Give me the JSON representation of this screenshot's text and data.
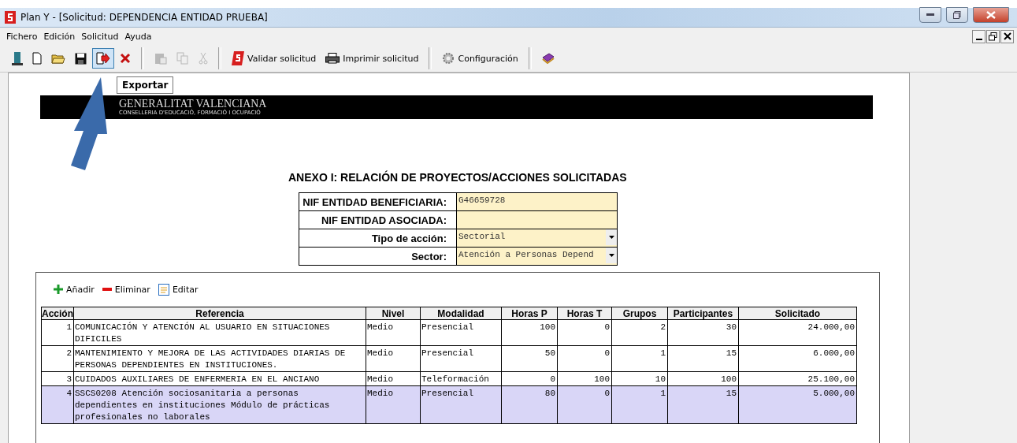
{
  "window": {
    "title": "Plan Y - [Solicitud: DEPENDENCIA ENTIDAD PRUEBA]"
  },
  "menu": [
    "Fichero",
    "Edición",
    "Solicitud",
    "Ayuda"
  ],
  "toolbar": [
    {
      "kind": "icon",
      "pressed": false,
      "disabled": false
    },
    {
      "kind": "icon",
      "pressed": false,
      "disabled": false
    },
    {
      "kind": "icon",
      "pressed": false,
      "disabled": false
    },
    {
      "kind": "icon",
      "pressed": false,
      "disabled": false
    },
    {
      "kind": "icon",
      "pressed": true,
      "disabled": false
    },
    {
      "kind": "icon",
      "pressed": false,
      "disabled": false
    },
    {
      "kind": "separator"
    },
    {
      "kind": "icon",
      "pressed": false,
      "disabled": true
    },
    {
      "kind": "icon",
      "pressed": false,
      "disabled": true
    },
    {
      "kind": "icon",
      "pressed": false,
      "disabled": true
    },
    {
      "kind": "separator"
    },
    {
      "kind": "labeled",
      "label": "Validar solicitud",
      "pressed": false,
      "disabled": false
    },
    {
      "kind": "labeled",
      "label": "Imprimir solicitud",
      "pressed": false,
      "disabled": false
    },
    {
      "kind": "separator"
    },
    {
      "kind": "labeled",
      "label": "Configuración",
      "pressed": false,
      "disabled": false
    },
    {
      "kind": "separator"
    },
    {
      "kind": "icon",
      "pressed": false,
      "disabled": false
    }
  ],
  "tooltip": "Exportar",
  "banner": {
    "title": "GENERALITAT VALENCIANA",
    "subtitle": "CONSELLERIA D'EDUCACIÓ, FORMACIÓ I OCUPACIÓ"
  },
  "heading": "ANEXO I: RELACIÓN DE PROYECTOS/ACCIONES SOLICITADAS",
  "form": [
    {
      "kind": "text",
      "label": "NIF ENTIDAD BENEFICIARIA:",
      "value": "G46659728"
    },
    {
      "kind": "text",
      "label": "NIF ENTIDAD ASOCIADA:"
    },
    {
      "kind": "select",
      "label": "Tipo de acción:",
      "value": "Sectorial"
    },
    {
      "kind": "select",
      "label": "Sector:",
      "value": "Atención a Personas Depend"
    }
  ],
  "grid_toolbar": [
    "Añadir",
    "Eliminar",
    "Editar"
  ],
  "table": {
    "columns": [
      "Acción",
      "Referencia",
      "Nivel",
      "Modalidad",
      "Horas P",
      "Horas T",
      "Grupos",
      "Participantes",
      "Solicitado"
    ],
    "rows": [
      {
        "selected": false,
        "cells": [
          "1",
          "COMUNICACIÓN Y ATENCIÓN AL USUARIO EN SITUACIONES DIFICILES",
          "Medio",
          "Presencial",
          "100",
          "0",
          "2",
          "30",
          "24.000,00"
        ]
      },
      {
        "selected": false,
        "cells": [
          "2",
          "MANTENIMIENTO Y MEJORA DE LAS ACTIVIDADES DIARIAS DE PERSONAS DEPENDIENTES EN INSTITUCIONES.",
          "Medio",
          "Presencial",
          "50",
          "0",
          "1",
          "15",
          "6.000,00"
        ]
      },
      {
        "selected": false,
        "cells": [
          "3",
          "CUIDADOS AUXILIARES DE ENFERMERIA EN EL ANCIANO",
          "Medio",
          "Teleformación",
          "0",
          "100",
          "10",
          "100",
          "25.100,00"
        ]
      },
      {
        "selected": true,
        "cells": [
          "4",
          "SSCS0208 Atención sociosanitaria a personas dependientes en instituciones Módulo de prácticas profesionales no laborales",
          "Medio",
          "Presencial",
          "80",
          "0",
          "1",
          "15",
          "5.000,00"
        ]
      }
    ]
  }
}
